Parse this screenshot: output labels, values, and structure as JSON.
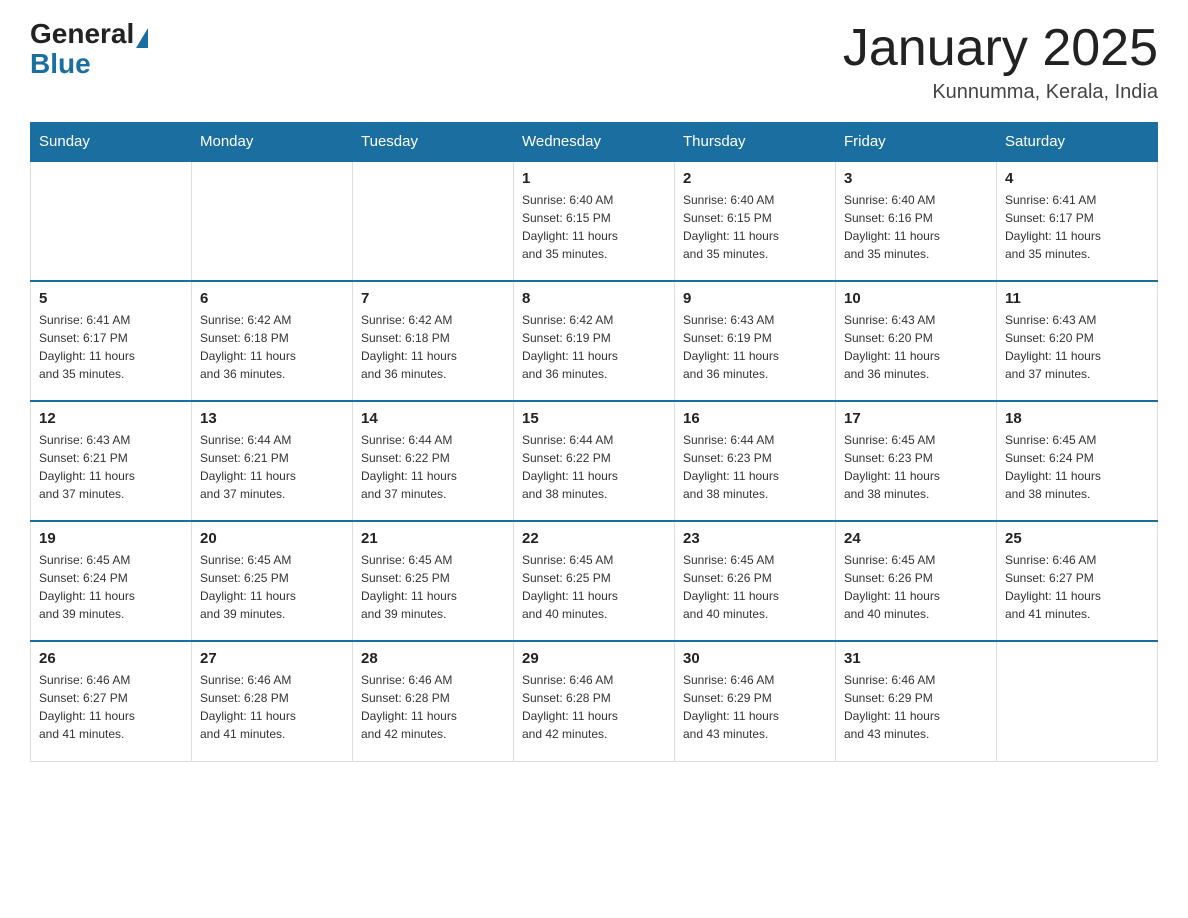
{
  "header": {
    "logo_general": "General",
    "logo_blue": "Blue",
    "title": "January 2025",
    "subtitle": "Kunnumma, Kerala, India"
  },
  "days_of_week": [
    "Sunday",
    "Monday",
    "Tuesday",
    "Wednesday",
    "Thursday",
    "Friday",
    "Saturday"
  ],
  "weeks": [
    [
      {
        "day": "",
        "info": ""
      },
      {
        "day": "",
        "info": ""
      },
      {
        "day": "",
        "info": ""
      },
      {
        "day": "1",
        "info": "Sunrise: 6:40 AM\nSunset: 6:15 PM\nDaylight: 11 hours\nand 35 minutes."
      },
      {
        "day": "2",
        "info": "Sunrise: 6:40 AM\nSunset: 6:15 PM\nDaylight: 11 hours\nand 35 minutes."
      },
      {
        "day": "3",
        "info": "Sunrise: 6:40 AM\nSunset: 6:16 PM\nDaylight: 11 hours\nand 35 minutes."
      },
      {
        "day": "4",
        "info": "Sunrise: 6:41 AM\nSunset: 6:17 PM\nDaylight: 11 hours\nand 35 minutes."
      }
    ],
    [
      {
        "day": "5",
        "info": "Sunrise: 6:41 AM\nSunset: 6:17 PM\nDaylight: 11 hours\nand 35 minutes."
      },
      {
        "day": "6",
        "info": "Sunrise: 6:42 AM\nSunset: 6:18 PM\nDaylight: 11 hours\nand 36 minutes."
      },
      {
        "day": "7",
        "info": "Sunrise: 6:42 AM\nSunset: 6:18 PM\nDaylight: 11 hours\nand 36 minutes."
      },
      {
        "day": "8",
        "info": "Sunrise: 6:42 AM\nSunset: 6:19 PM\nDaylight: 11 hours\nand 36 minutes."
      },
      {
        "day": "9",
        "info": "Sunrise: 6:43 AM\nSunset: 6:19 PM\nDaylight: 11 hours\nand 36 minutes."
      },
      {
        "day": "10",
        "info": "Sunrise: 6:43 AM\nSunset: 6:20 PM\nDaylight: 11 hours\nand 36 minutes."
      },
      {
        "day": "11",
        "info": "Sunrise: 6:43 AM\nSunset: 6:20 PM\nDaylight: 11 hours\nand 37 minutes."
      }
    ],
    [
      {
        "day": "12",
        "info": "Sunrise: 6:43 AM\nSunset: 6:21 PM\nDaylight: 11 hours\nand 37 minutes."
      },
      {
        "day": "13",
        "info": "Sunrise: 6:44 AM\nSunset: 6:21 PM\nDaylight: 11 hours\nand 37 minutes."
      },
      {
        "day": "14",
        "info": "Sunrise: 6:44 AM\nSunset: 6:22 PM\nDaylight: 11 hours\nand 37 minutes."
      },
      {
        "day": "15",
        "info": "Sunrise: 6:44 AM\nSunset: 6:22 PM\nDaylight: 11 hours\nand 38 minutes."
      },
      {
        "day": "16",
        "info": "Sunrise: 6:44 AM\nSunset: 6:23 PM\nDaylight: 11 hours\nand 38 minutes."
      },
      {
        "day": "17",
        "info": "Sunrise: 6:45 AM\nSunset: 6:23 PM\nDaylight: 11 hours\nand 38 minutes."
      },
      {
        "day": "18",
        "info": "Sunrise: 6:45 AM\nSunset: 6:24 PM\nDaylight: 11 hours\nand 38 minutes."
      }
    ],
    [
      {
        "day": "19",
        "info": "Sunrise: 6:45 AM\nSunset: 6:24 PM\nDaylight: 11 hours\nand 39 minutes."
      },
      {
        "day": "20",
        "info": "Sunrise: 6:45 AM\nSunset: 6:25 PM\nDaylight: 11 hours\nand 39 minutes."
      },
      {
        "day": "21",
        "info": "Sunrise: 6:45 AM\nSunset: 6:25 PM\nDaylight: 11 hours\nand 39 minutes."
      },
      {
        "day": "22",
        "info": "Sunrise: 6:45 AM\nSunset: 6:25 PM\nDaylight: 11 hours\nand 40 minutes."
      },
      {
        "day": "23",
        "info": "Sunrise: 6:45 AM\nSunset: 6:26 PM\nDaylight: 11 hours\nand 40 minutes."
      },
      {
        "day": "24",
        "info": "Sunrise: 6:45 AM\nSunset: 6:26 PM\nDaylight: 11 hours\nand 40 minutes."
      },
      {
        "day": "25",
        "info": "Sunrise: 6:46 AM\nSunset: 6:27 PM\nDaylight: 11 hours\nand 41 minutes."
      }
    ],
    [
      {
        "day": "26",
        "info": "Sunrise: 6:46 AM\nSunset: 6:27 PM\nDaylight: 11 hours\nand 41 minutes."
      },
      {
        "day": "27",
        "info": "Sunrise: 6:46 AM\nSunset: 6:28 PM\nDaylight: 11 hours\nand 41 minutes."
      },
      {
        "day": "28",
        "info": "Sunrise: 6:46 AM\nSunset: 6:28 PM\nDaylight: 11 hours\nand 42 minutes."
      },
      {
        "day": "29",
        "info": "Sunrise: 6:46 AM\nSunset: 6:28 PM\nDaylight: 11 hours\nand 42 minutes."
      },
      {
        "day": "30",
        "info": "Sunrise: 6:46 AM\nSunset: 6:29 PM\nDaylight: 11 hours\nand 43 minutes."
      },
      {
        "day": "31",
        "info": "Sunrise: 6:46 AM\nSunset: 6:29 PM\nDaylight: 11 hours\nand 43 minutes."
      },
      {
        "day": "",
        "info": ""
      }
    ]
  ]
}
